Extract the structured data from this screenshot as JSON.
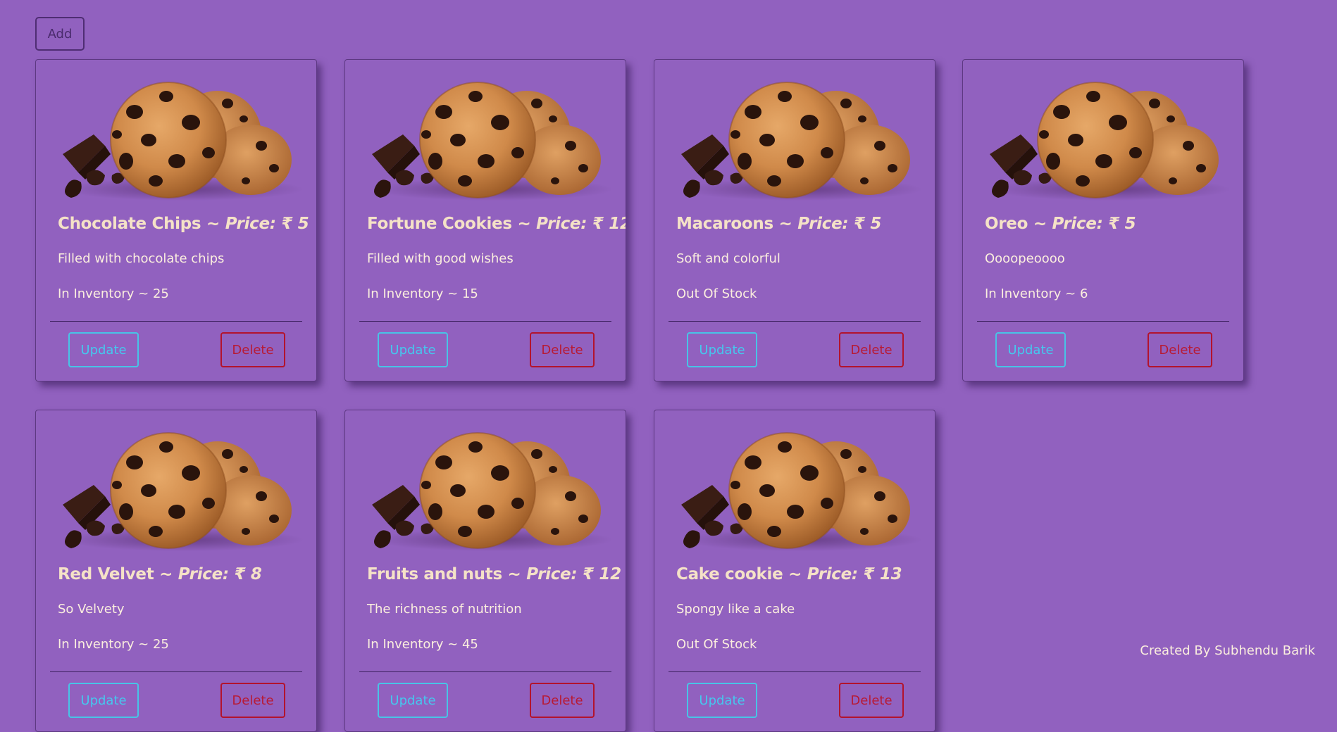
{
  "toolbar": {
    "add_label": "Add"
  },
  "cards": [
    {
      "name": "Chocolate Chips",
      "price_label": "Price: ₹ 5",
      "description": "Filled with chocolate chips",
      "stock": "In Inventory ~ 25",
      "update_label": "Update",
      "delete_label": "Delete"
    },
    {
      "name": "Fortune Cookies",
      "price_label": "Price: ₹ 12",
      "description": "Filled with good wishes",
      "stock": "In Inventory ~ 15",
      "update_label": "Update",
      "delete_label": "Delete"
    },
    {
      "name": "Macaroons",
      "price_label": "Price: ₹ 5",
      "description": "Soft and colorful",
      "stock": "Out Of Stock",
      "update_label": "Update",
      "delete_label": "Delete"
    },
    {
      "name": "Oreo",
      "price_label": "Price: ₹ 5",
      "description": "Oooореoooo",
      "stock": "In Inventory ~ 6",
      "update_label": "Update",
      "delete_label": "Delete"
    },
    {
      "name": "Red Velvet",
      "price_label": "Price: ₹ 8",
      "description": "So Velvety",
      "stock": "In Inventory ~ 25",
      "update_label": "Update",
      "delete_label": "Delete"
    },
    {
      "name": "Fruits and nuts",
      "price_label": "Price: ₹ 12",
      "description": "The richness of nutrition",
      "stock": "In Inventory ~ 45",
      "update_label": "Update",
      "delete_label": "Delete"
    },
    {
      "name": "Cake cookie",
      "price_label": "Price: ₹ 13",
      "description": "Spongy like a cake",
      "stock": "Out Of Stock",
      "update_label": "Update",
      "delete_label": "Delete"
    }
  ],
  "footer": {
    "credit": "Created By Subhendu Barik"
  },
  "colors": {
    "background": "#9161bf",
    "title": "#f5e2c7",
    "update_accent": "#45c8ee",
    "delete_accent": "#b81a34"
  },
  "icons": {
    "card_image": "cookies-image"
  }
}
